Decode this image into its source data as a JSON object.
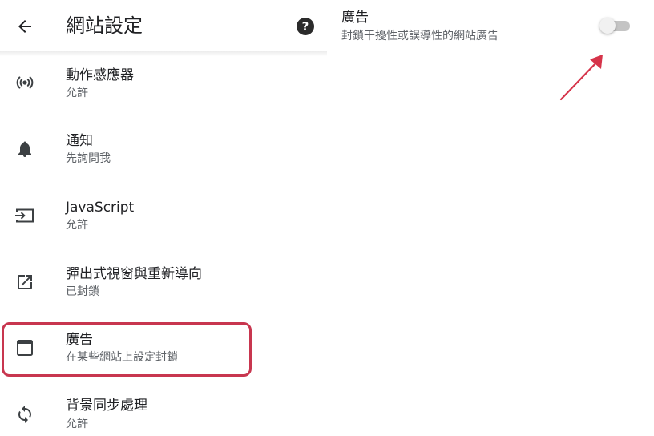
{
  "app_bar": {
    "title": "網站設定",
    "back_icon": "arrow-back-icon",
    "help_icon": "help-icon",
    "help_glyph": "?"
  },
  "settings": {
    "items": [
      {
        "title": "動作感應器",
        "subtitle": "允許",
        "icon": "sensors-icon"
      },
      {
        "title": "通知",
        "subtitle": "先詢問我",
        "icon": "bell-icon"
      },
      {
        "title": "JavaScript",
        "subtitle": "允許",
        "icon": "javascript-icon"
      },
      {
        "title": "彈出式視窗與重新導向",
        "subtitle": "已封鎖",
        "icon": "open-in-new-icon"
      },
      {
        "title": "廣告",
        "subtitle": "在某些網站上設定封鎖",
        "icon": "web-window-icon"
      },
      {
        "title": "背景同步處理",
        "subtitle": "允許",
        "icon": "sync-icon"
      }
    ],
    "highlighted_item": "廣告"
  },
  "ads_detail": {
    "title": "廣告",
    "description": "封鎖干擾性或誤導性的網站廣告",
    "toggle_on": false
  },
  "colors": {
    "highlight_border": "#c8364f",
    "arrow": "#d6344a",
    "secondary_text": "#5f6368",
    "toggle_track_off": "#c4c4c4"
  }
}
